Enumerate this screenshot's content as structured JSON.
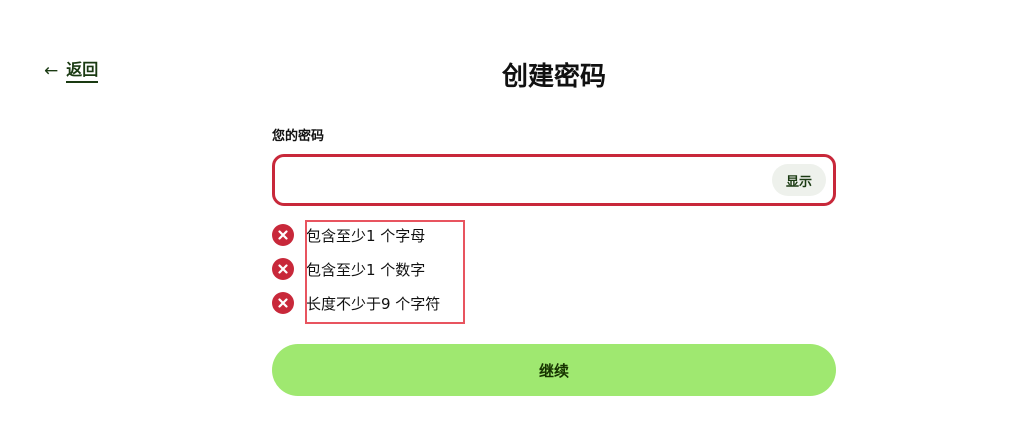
{
  "nav": {
    "back_arrow": "←",
    "back_label": "返回"
  },
  "header": {
    "title": "创建密码"
  },
  "form": {
    "password_label": "您的密码",
    "password_value": "",
    "show_label": "显示"
  },
  "rules": [
    {
      "text": "包含至少1 个字母",
      "status": "unmet",
      "icon": "x-circle-icon"
    },
    {
      "text": "包含至少1 个数字",
      "status": "unmet",
      "icon": "x-circle-icon"
    },
    {
      "text": "长度不少于9 个字符",
      "status": "unmet",
      "icon": "x-circle-icon"
    }
  ],
  "actions": {
    "continue_label": "继续"
  },
  "colors": {
    "error": "#c8283a",
    "primary_button": "#9fe870",
    "primary_text": "#163300",
    "link": "#1a3a12",
    "highlight_box": "#e8545f"
  }
}
